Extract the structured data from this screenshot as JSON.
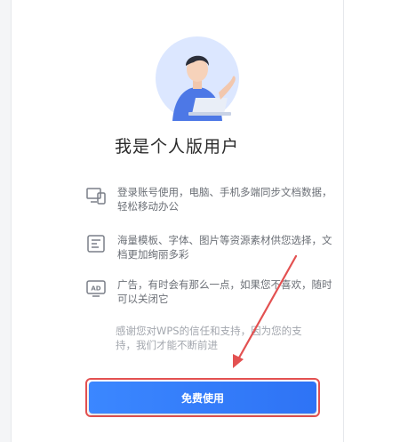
{
  "title": "我是个人版用户",
  "features": [
    {
      "icon": "devices-icon",
      "text": "登录账号使用，电脑、手机多端同步文档数据，轻松移动办公"
    },
    {
      "icon": "template-icon",
      "text": "海量模板、字体、图片等资源素材供您选择，文档更加绚丽多彩"
    },
    {
      "icon": "ad-icon",
      "text": "广告，有时会有那么一点，如果您不喜欢，随时可以关闭它"
    }
  ],
  "thanks": "感谢您对WPS的信任和支持，因为您的支持，我们才能不断前进",
  "cta": {
    "label": "免费使用"
  },
  "colors": {
    "accent": "#2e73f5",
    "annotation": "#e35151",
    "avatar_bg": "#dce7ff"
  }
}
